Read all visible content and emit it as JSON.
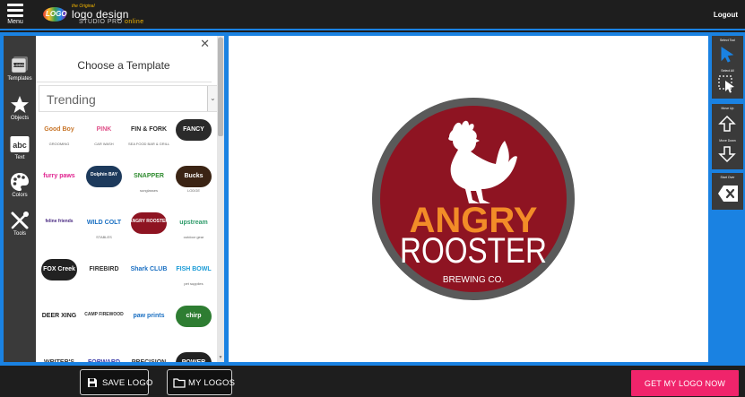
{
  "header": {
    "menu_label": "Menu",
    "brand": {
      "mark_text": "LOGO",
      "superscript": "the Original",
      "name": "logo design",
      "sub_prefix": "STUDIO PRO",
      "sub_suffix": "online"
    },
    "logout_label": "Logout"
  },
  "sidebar": {
    "items": [
      {
        "label": "Templates",
        "icon": "templates-icon"
      },
      {
        "label": "Objects",
        "icon": "star-icon"
      },
      {
        "label": "Text",
        "icon": "text-abc-icon"
      },
      {
        "label": "Colors",
        "icon": "palette-icon"
      },
      {
        "label": "Tools",
        "icon": "tools-icon"
      }
    ]
  },
  "template_panel": {
    "close_symbol": "✕",
    "title": "Choose a Template",
    "category": "Trending",
    "templates": [
      {
        "t1": "Good Boy",
        "t2": "GROOMING",
        "color": "#c8762a"
      },
      {
        "t1": "PINK",
        "t2": "CAR WASH",
        "color": "#e0528a"
      },
      {
        "t1": "FIN & FORK",
        "t2": "SEA FOOD BAR & GRILL",
        "color": "#2b2b2b"
      },
      {
        "t1": "FANCY",
        "t2": "",
        "color": "#ffffff"
      },
      {
        "t1": "furry paws",
        "t2": "",
        "color": "#e0228f"
      },
      {
        "t1": "Dolphin BAY",
        "t2": "",
        "color": "#ffffff"
      },
      {
        "t1": "SNAPPER",
        "t2": "sunglasses",
        "color": "#2e8b2e"
      },
      {
        "t1": "Bucks",
        "t2": "LODGE",
        "color": "#ffffff"
      },
      {
        "t1": "feline friends",
        "t2": "",
        "color": "#4a2a82"
      },
      {
        "t1": "WILD COLT",
        "t2": "STABLES",
        "color": "#1a6fc2"
      },
      {
        "t1": "ANGRY ROOSTER",
        "t2": "",
        "color": "#ffffff"
      },
      {
        "t1": "upstream",
        "t2": "outdoor gear",
        "color": "#2e9b6a"
      },
      {
        "t1": "FOX Creek",
        "t2": "",
        "color": "#ffffff"
      },
      {
        "t1": "FIREBIRD",
        "t2": "",
        "color": "#333333"
      },
      {
        "t1": "Shark CLUB",
        "t2": "",
        "color": "#1a6fc2"
      },
      {
        "t1": "FISH BOWL",
        "t2": "pet supplies",
        "color": "#1a9bd6"
      },
      {
        "t1": "DEER XING",
        "t2": "",
        "color": "#222222"
      },
      {
        "t1": "CAMP FIREWOOD",
        "t2": "",
        "color": "#333333"
      },
      {
        "t1": "paw prints",
        "t2": "",
        "color": "#1a6fc2"
      },
      {
        "t1": "chirp",
        "t2": "",
        "color": "#ffffff"
      },
      {
        "t1": "WRITER'S",
        "t2": "",
        "color": "#333333"
      },
      {
        "t1": "FORWARD",
        "t2": "",
        "color": "#3a3aa8"
      },
      {
        "t1": "PRECISION",
        "t2": "",
        "color": "#333333"
      },
      {
        "t1": "POWER",
        "t2": "",
        "color": "#ffffff"
      }
    ]
  },
  "canvas": {
    "logo": {
      "line1": "ANGRY",
      "line2": "ROOSTER",
      "line3": "BREWING CO.",
      "colors": {
        "outer_ring": "#5a5a5a",
        "inner": "#8e1422",
        "accent": "#f28c28",
        "text": "#ffffff"
      }
    }
  },
  "right_toolbar": {
    "select_tool": "Select Tool",
    "select_all": "Select All",
    "move_up": "Move Up",
    "move_down": "Move Down",
    "start_over": "Start Over"
  },
  "footer": {
    "save_label": "SAVE LOGO",
    "my_logos_label": "MY LOGOS",
    "cta_label": "GET MY LOGO NOW"
  }
}
